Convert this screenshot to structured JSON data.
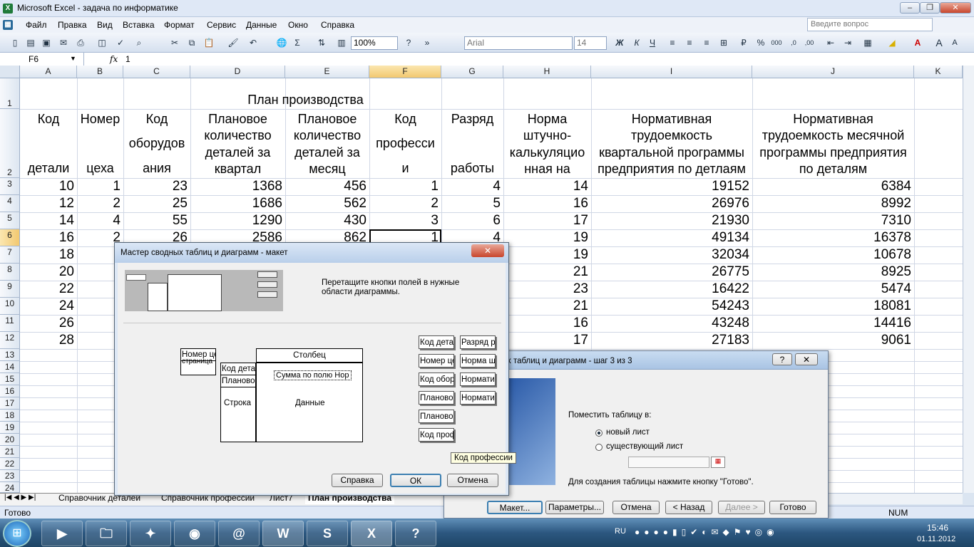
{
  "window": {
    "title": "Microsoft Excel - задача по информатике",
    "help_placeholder": "Введите вопрос"
  },
  "menu": [
    "Файл",
    "Правка",
    "Вид",
    "Вставка",
    "Формат",
    "Сервис",
    "Данные",
    "Окно",
    "Справка"
  ],
  "toolbar": {
    "zoom": "100%",
    "font": "Arial",
    "size": "14"
  },
  "formula": {
    "namebox": "F6",
    "fx": "fx",
    "value": "1"
  },
  "columns": [
    "A",
    "B",
    "C",
    "D",
    "E",
    "F",
    "G",
    "H",
    "I",
    "J",
    "K"
  ],
  "rows": [
    "1",
    "2",
    "3",
    "4",
    "5",
    "6",
    "7",
    "8",
    "9",
    "10",
    "11",
    "12",
    "13",
    "14",
    "15",
    "16",
    "17",
    "18",
    "19",
    "20",
    "21",
    "22",
    "23",
    "24"
  ],
  "sheet": {
    "title": "План производства",
    "headers": [
      [
        "Код",
        "",
        "детали"
      ],
      [
        "Номер",
        "",
        "цеха"
      ],
      [
        "Код",
        "оборудов",
        "ания"
      ],
      [
        "Плановое",
        "количество",
        "деталей за",
        "квартал"
      ],
      [
        "Плановое",
        "количество",
        "деталей за",
        "месяц"
      ],
      [
        "Код",
        "професси",
        "и"
      ],
      [
        "Разряд",
        "",
        "работы"
      ],
      [
        "Норма",
        "штучно-",
        "калькуляцио",
        "нная на"
      ],
      [
        "Нормативная",
        "трудоемкость",
        "квартальной программы",
        "предприятия по детлаям"
      ],
      [
        "Нормативная",
        "трудоемкость месячной",
        "программы предприятия",
        "по деталям"
      ]
    ],
    "data": [
      [
        "10",
        "1",
        "23",
        "1368",
        "456",
        "1",
        "4",
        "14",
        "19152",
        "6384"
      ],
      [
        "12",
        "2",
        "25",
        "1686",
        "562",
        "2",
        "5",
        "16",
        "26976",
        "8992"
      ],
      [
        "14",
        "4",
        "55",
        "1290",
        "430",
        "3",
        "6",
        "17",
        "21930",
        "7310"
      ],
      [
        "16",
        "2",
        "26",
        "2586",
        "862",
        "1",
        "4",
        "19",
        "49134",
        "16378"
      ],
      [
        "18",
        "",
        "",
        "",
        "",
        "",
        "",
        "19",
        "32034",
        "10678"
      ],
      [
        "20",
        "",
        "",
        "",
        "",
        "",
        "",
        "21",
        "26775",
        "8925"
      ],
      [
        "22",
        "",
        "",
        "",
        "",
        "",
        "",
        "23",
        "16422",
        "5474"
      ],
      [
        "24",
        "",
        "",
        "",
        "",
        "",
        "",
        "21",
        "54243",
        "18081"
      ],
      [
        "26",
        "",
        "",
        "",
        "",
        "",
        "",
        "16",
        "43248",
        "14416"
      ],
      [
        "28",
        "",
        "",
        "",
        "",
        "",
        "",
        "17",
        "27183",
        "9061"
      ]
    ]
  },
  "sheet_tabs": [
    "Справочник деталей",
    "Справочник профессии",
    "Лист7",
    "План производства"
  ],
  "status": {
    "left": "Готово",
    "num": "NUM"
  },
  "wizard3": {
    "title_partial": "х таблиц и диаграмм - шаг 3 из 3",
    "place_label": "Поместить таблицу в:",
    "opt_new": "новый лист",
    "opt_existing": "существующий лист",
    "hint": "Для создания таблицы нажмите кнопку \"Готово\".",
    "buttons": [
      "Макет...",
      "Параметры...",
      "Отмена",
      "< Назад",
      "Далее >",
      "Готово"
    ]
  },
  "layout_dialog": {
    "title": "Мастер сводных таблиц и диаграмм - макет",
    "instruction": "Перетащите кнопки полей в нужные области диаграммы.",
    "page_area": "Номер це",
    "page_area_under": "страница",
    "column_area": "Столбец",
    "row_area": "Строка",
    "data_area": "Данные",
    "row_fields": [
      "Код дета",
      "Плановое"
    ],
    "data_field": "Сумма по полю Нор",
    "fields_left": [
      "Код дета",
      "Номер це",
      "Код обор",
      "Плановое",
      "Плановое",
      "Код проф"
    ],
    "fields_right": [
      "Разряд р",
      "Норма шт",
      "Норматив",
      "Норматив"
    ],
    "tooltip": "Код профессии",
    "buttons": {
      "help": "Справка",
      "ok": "ОК",
      "cancel": "Отмена"
    }
  },
  "taskbar": {
    "lang": "RU",
    "time": "15:46",
    "date": "01.11.2012"
  }
}
